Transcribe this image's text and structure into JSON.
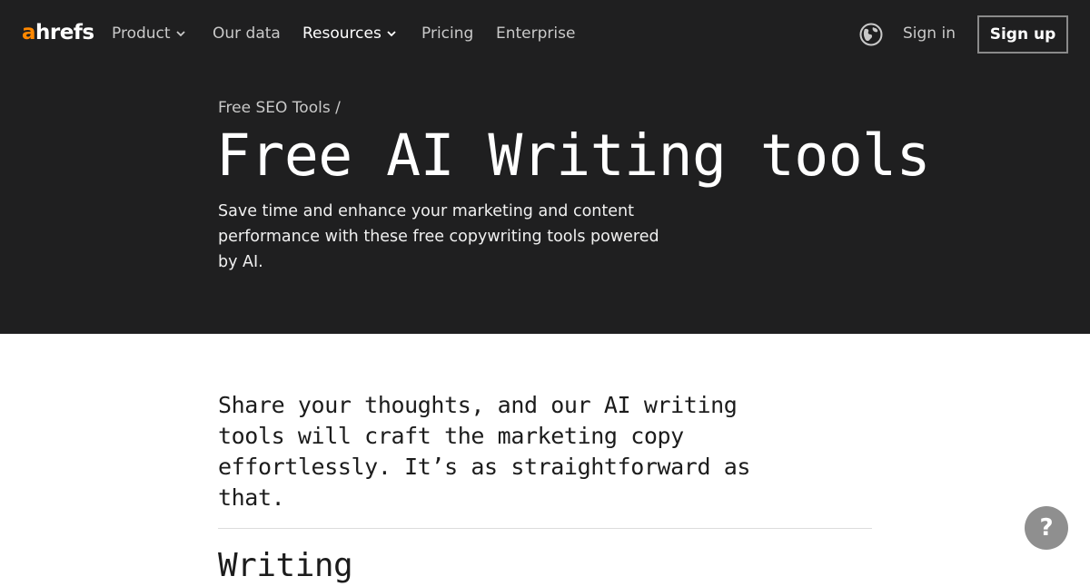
{
  "nav": {
    "logo_accent": "a",
    "logo_rest": "hrefs",
    "items": [
      {
        "label": "Product",
        "has_dropdown": true
      },
      {
        "label": "Our data",
        "has_dropdown": false
      },
      {
        "label": "Resources",
        "has_dropdown": true,
        "active": true
      },
      {
        "label": "Pricing",
        "has_dropdown": false
      },
      {
        "label": "Enterprise",
        "has_dropdown": false
      }
    ],
    "language_icon": "globe-icon",
    "sign_in": "Sign in",
    "sign_up": "Sign up"
  },
  "hero": {
    "breadcrumb_link": "Free SEO Tools",
    "breadcrumb_sep": "/",
    "title": "Free AI Writing tools",
    "description": "Save time and enhance your marketing and content performance with these free copywriting tools powered by AI."
  },
  "main": {
    "intro": "Share your thoughts, and our AI writing tools will craft the marketing copy effortlessly. It’s as straightforward as that.",
    "section_heading": "Writing"
  },
  "help_button": {
    "label": "?",
    "icon": "help-icon"
  },
  "colors": {
    "hero_bg": "#1f1f20",
    "brand_orange": "#ff8800",
    "help_bg": "#8f8f8f"
  }
}
